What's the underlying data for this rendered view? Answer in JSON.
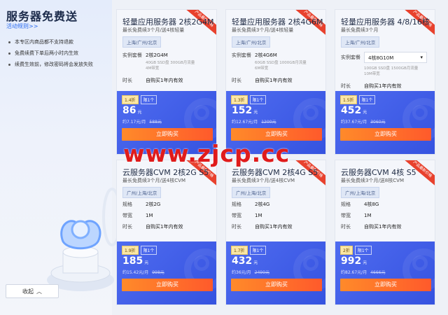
{
  "sidebar": {
    "title": "服务器免费送",
    "rules_link": "活动规则>>",
    "notes": [
      "本专区内商品都不支持退款",
      "免费续费下单后两小时内生效",
      "续费生效前，修改密码将会发放失败"
    ],
    "collapse_label": "收起"
  },
  "watermark": "www.zjcp.cc",
  "colors": {
    "accent": "#3f5ce6",
    "button": "#ff6a2b",
    "ribbon": "#e8412d",
    "link": "#2a6bf0"
  },
  "cards": [
    {
      "title": "轻量应用服务器 2核2G4M",
      "subtitle": "最长免费续3个月/送4核轻量",
      "region": "上海/广州/北京",
      "ribbon": "产品最新价格",
      "spec_label": "实例套餐",
      "spec_value": "2核2G4M",
      "spec_note": "40GB SSD盘 300GB月流量 4M带宽",
      "duration_label": "时长",
      "duration_value": "自购买1年内有效",
      "discount": "1.4折",
      "limit": "限1个",
      "price": "86",
      "unit": "元",
      "per_month": "约7.17元/月",
      "original": "588元",
      "buy_label": "立即购买"
    },
    {
      "title": "轻量应用服务器 2核4G6M",
      "subtitle": "最长免费续3个月/送4核轻量",
      "region": "上海/广州/北京",
      "ribbon": "产品最新价格",
      "spec_label": "实例套餐",
      "spec_value": "2核4G6M",
      "spec_note": "60GB SSD盘 1000GB月流量 6M带宽",
      "duration_label": "时长",
      "duration_value": "自购买1年内有效",
      "discount": "1.3折",
      "limit": "限1个",
      "price": "152",
      "unit": "元",
      "per_month": "约12.67元/月",
      "original": "1200元",
      "buy_label": "立即购买"
    },
    {
      "title": "轻量应用服务器 4/8/16核",
      "subtitle": "最长免费续3个月",
      "region": "上海/广州/北京",
      "ribbon": "产品最新价格",
      "spec_label": "实例套餐",
      "spec_value": "4核8G10M",
      "spec_note": "100GB SSD盘 1500GB月流量 10M带宽",
      "duration_label": "时长",
      "duration_value": "自购买1年内有效",
      "discount": "1.5折",
      "limit": "限1个",
      "price": "452",
      "unit": "元",
      "per_month": "约37.67元/月",
      "original": "3060元",
      "buy_label": "立即购买"
    },
    {
      "title": "云服务器CVM 2核2G S5",
      "subtitle": "最长免费续3个月/送4核CVM",
      "region": "广州/上海/北京",
      "ribbon": "产品最新价格",
      "spec_label": "规格",
      "spec_value": "2核2G",
      "bw_label": "带宽",
      "bw_value": "1M",
      "duration_label": "时长",
      "duration_value": "自购买1年内有效",
      "discount": "1.9折",
      "limit": "限1个",
      "price": "185",
      "unit": "元",
      "per_month": "约15.42元/月",
      "original": "998元",
      "buy_label": "立即购买"
    },
    {
      "title": "云服务器CVM 2核4G S5",
      "subtitle": "最长免费续3个月/送4核CVM",
      "region": "广州/上海/北京",
      "ribbon": "产品最新价格",
      "spec_label": "规格",
      "spec_value": "2核4G",
      "bw_label": "带宽",
      "bw_value": "1M",
      "duration_label": "时长",
      "duration_value": "自购买1年内有效",
      "discount": "1.7折",
      "limit": "限1个",
      "price": "432",
      "unit": "元",
      "per_month": "约36元/月",
      "original": "2490元",
      "buy_label": "立即购买"
    },
    {
      "title": "云服务器CVM 4核 S5",
      "subtitle": "最长免费续3个月/送8核CVM",
      "region": "广州/上海/北京",
      "ribbon": "产品最新价格",
      "spec_label": "规格",
      "spec_value": "4核8G",
      "bw_label": "带宽",
      "bw_value": "1M",
      "duration_label": "时长",
      "duration_value": "自购买1年内有效",
      "discount": "2折",
      "limit": "限1个",
      "price": "992",
      "unit": "元",
      "per_month": "约82.67元/月",
      "original": "4666元",
      "buy_label": "立即购买"
    }
  ]
}
